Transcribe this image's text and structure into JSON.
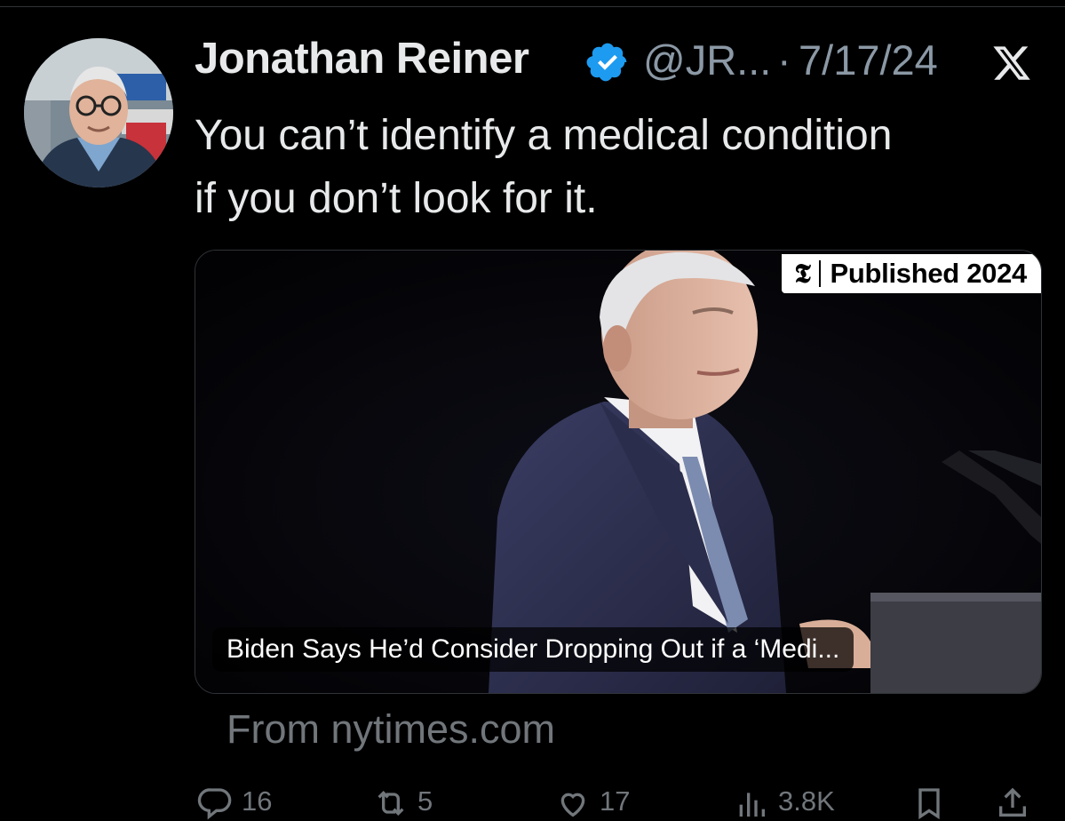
{
  "tweet": {
    "author_name": "Jonathan Reiner",
    "handle": "@JR...",
    "separator": "·",
    "date": "7/17/24",
    "text": "You can’t identify a medical condition\nif you don’t look for it."
  },
  "card": {
    "publisher_icon": "nyt-t-icon",
    "publisher_glyph": "𝕿",
    "published_label": "Published 2024",
    "headline": "Biden Says He’d Consider Dropping Out if a ‘Medi...",
    "source": "From nytimes.com"
  },
  "actions": {
    "replies": "16",
    "reposts": "5",
    "likes": "17",
    "views": "3.8K"
  },
  "icons": [
    "verified-badge-icon",
    "x-logo-icon",
    "reply-icon",
    "repost-icon",
    "like-icon",
    "views-icon",
    "bookmark-icon",
    "share-icon"
  ],
  "colors": {
    "background": "#000000",
    "text": "#e7e9ea",
    "secondary": "#71767b",
    "verified": "#1d9bf0"
  }
}
